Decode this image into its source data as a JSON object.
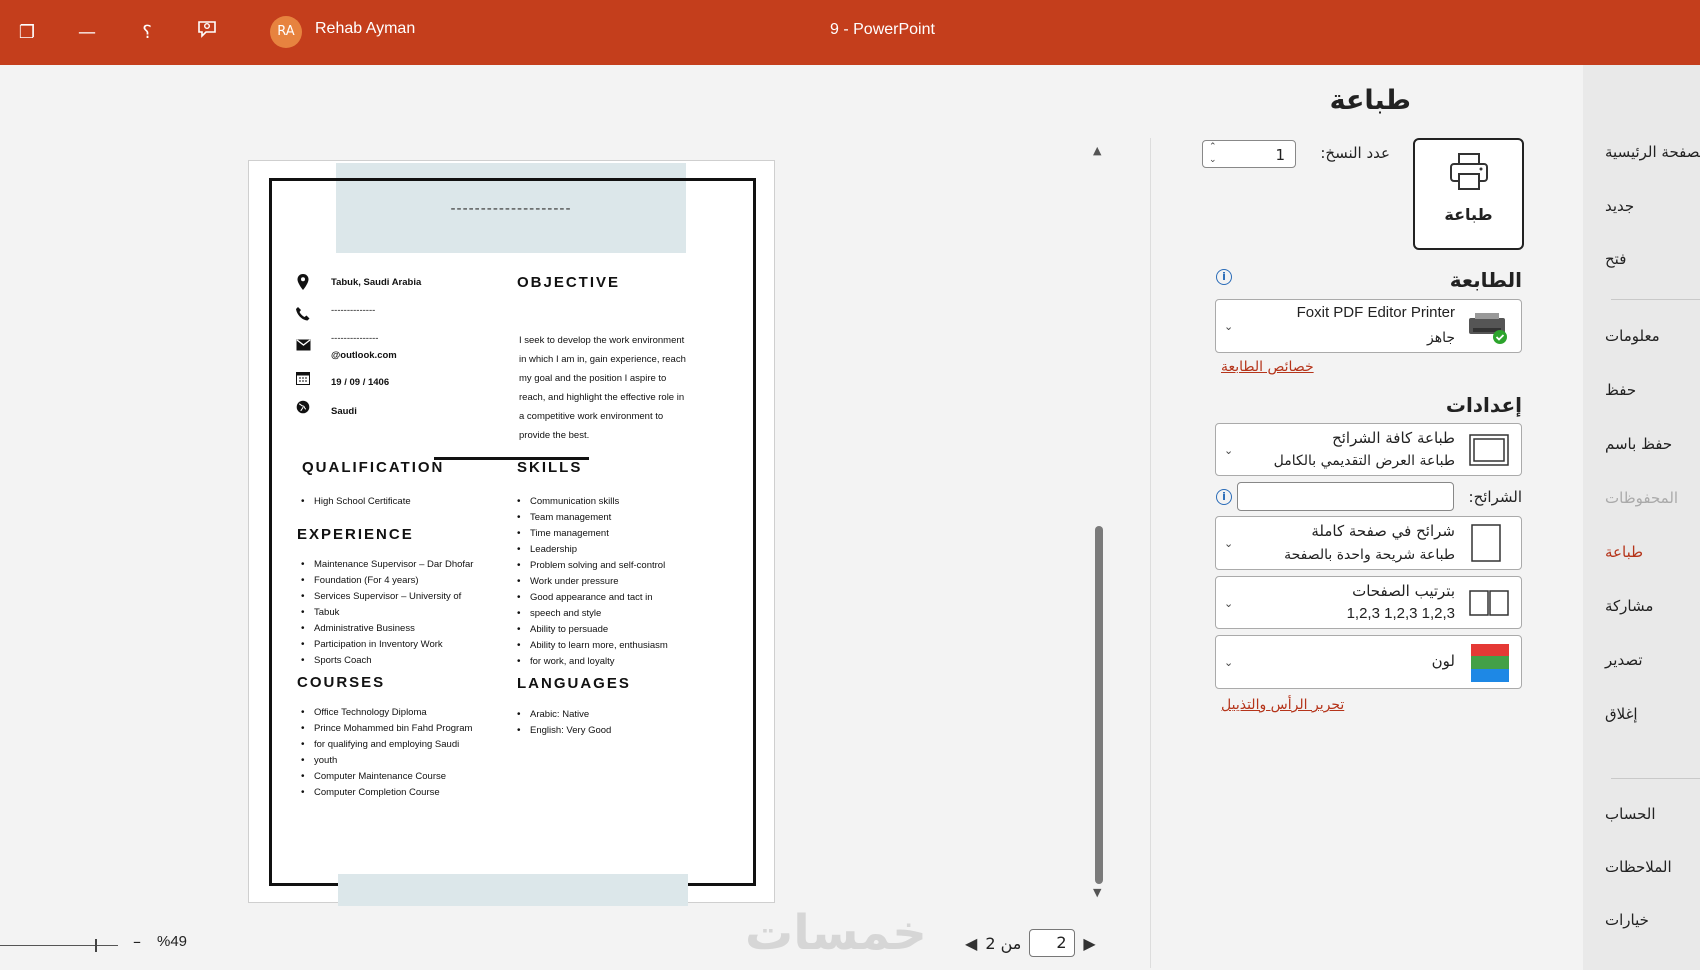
{
  "titlebar": {
    "user_initials": "RA",
    "user_name": "Rehab Ayman",
    "doc_title": "9  -  PowerPoint",
    "icons": [
      "restore-icon",
      "minimize-icon",
      "help-icon",
      "coauthor-icon"
    ]
  },
  "page": {
    "heading": "طباعة"
  },
  "print": {
    "button_label": "طباعة",
    "copies_label": "عدد النسخ:",
    "copies_value": "1"
  },
  "printer": {
    "section_title": "الطابعة",
    "name": "Foxit PDF Editor Printer",
    "status": "جاهز",
    "properties_link": "خصائص الطابعة"
  },
  "settings": {
    "section_title": "إعدادات",
    "range": {
      "line1": "طباعة كافة الشرائح",
      "line2": "طباعة العرض التقديمي بالكامل"
    },
    "slides_label": "الشرائح:",
    "slides_value": "",
    "layout": {
      "line1": "شرائح في صفحة كاملة",
      "line2": "طباعة شريحة واحدة بالصفحة"
    },
    "collate": {
      "line1": "بترتيب الصفحات",
      "line2": "1,2,3    1,2,3    1,2,3"
    },
    "color": {
      "line1": "لون"
    },
    "header_footer_link": "تحرير الرأس والتذييل"
  },
  "pager": {
    "current": "2",
    "of_label": "من 2"
  },
  "zoom": {
    "percent": "%49"
  },
  "watermark": "خمسات",
  "nav": {
    "items": [
      {
        "label": "الصفحة الرئيسية",
        "state": "normal"
      },
      {
        "label": "جديد",
        "state": "normal"
      },
      {
        "label": "فتح",
        "state": "normal"
      },
      {
        "label": "معلومات",
        "state": "normal"
      },
      {
        "label": "حفظ",
        "state": "normal"
      },
      {
        "label": "حفظ باسم",
        "state": "normal"
      },
      {
        "label": "المحفوظات",
        "state": "disabled"
      },
      {
        "label": "طباعة",
        "state": "active"
      },
      {
        "label": "مشاركة",
        "state": "normal"
      },
      {
        "label": "تصدير",
        "state": "normal"
      },
      {
        "label": "إغلاق",
        "state": "normal"
      },
      {
        "label": "الحساب",
        "state": "normal"
      },
      {
        "label": "الملاحظات",
        "state": "normal"
      },
      {
        "label": "خيارات",
        "state": "normal"
      }
    ]
  },
  "slide": {
    "top_dashes": "--------------------",
    "contact": {
      "location": "Tabuk, Saudi Arabia",
      "phone": "--------------",
      "email_dashes": "---------------",
      "email": "@outlook.com",
      "dob": "19 / 09 / 1406",
      "nationality": "Saudi"
    },
    "objective_title": "OBJECTIVE",
    "objective_lines": [
      "I seek to develop the work environment",
      "in which I am in, gain experience, reach",
      "my goal and the position I aspire to",
      "reach, and highlight the effective role in",
      "a competitive work environment to",
      "provide the best."
    ],
    "qualification_title": "QUALIFICATION",
    "qualification": [
      "High School Certificate"
    ],
    "skills_title": "SKILLS",
    "skills": [
      "Communication skills",
      "Team management",
      "Time management",
      "Leadership",
      "Problem solving and self-control",
      "Work under pressure",
      "Good appearance and tact in",
      "speech and style",
      "Ability to persuade",
      "Ability to learn more, enthusiasm",
      "for work, and loyalty"
    ],
    "experience_title": "EXPERIENCE",
    "experience": [
      "Maintenance Supervisor – Dar Dhofar",
      "Foundation (For 4 years)",
      "Services Supervisor – University of",
      "Tabuk",
      "Administrative Business",
      "Participation in Inventory Work",
      "Sports Coach"
    ],
    "courses_title": "COURSES",
    "courses": [
      "Office Technology Diploma",
      "Prince Mohammed bin Fahd Program",
      "for qualifying and employing Saudi",
      "youth",
      "Computer Maintenance Course",
      "Computer Completion Course"
    ],
    "languages_title": "LANGUAGES",
    "languages": [
      "Arabic: Native",
      "English: Very Good"
    ]
  }
}
